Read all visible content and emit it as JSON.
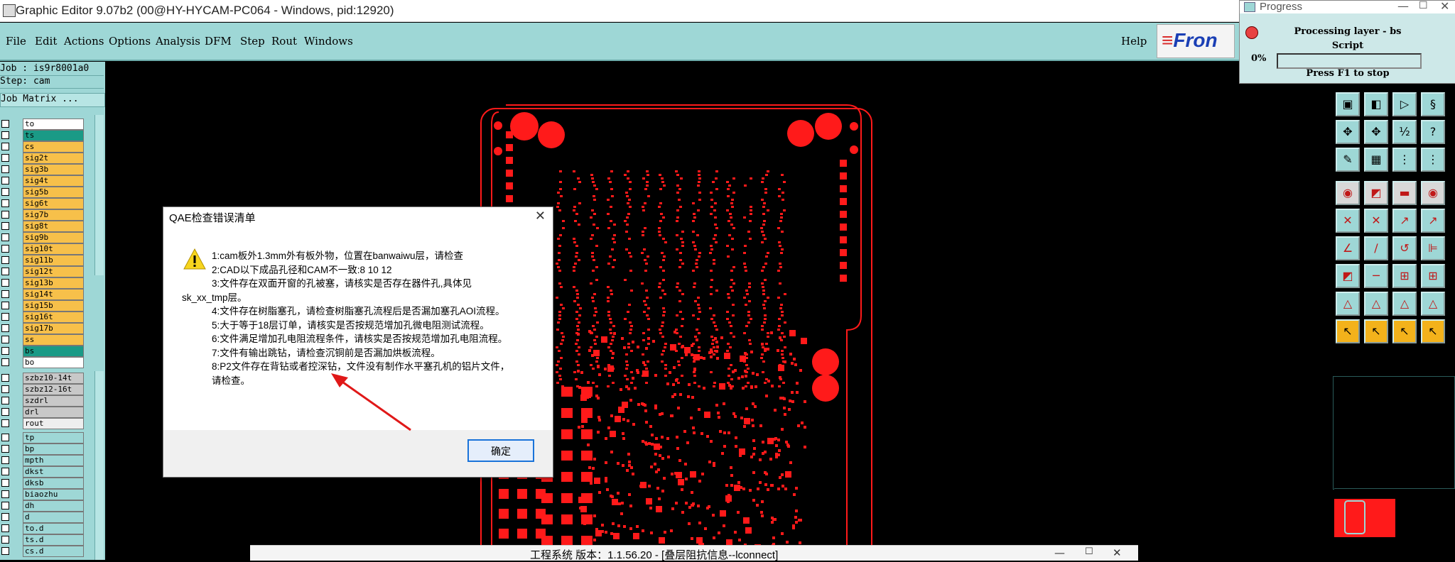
{
  "window": {
    "title": "Graphic Editor 9.07b2 (00@HY-HYCAM-PC064 - Windows, pid:12920)"
  },
  "menubar": {
    "items": [
      "File",
      "Edit",
      "Actions",
      "Options",
      "Analysis",
      "DFM",
      "Step",
      "Rout",
      "Windows"
    ],
    "help": "Help",
    "logo_text": "Fron"
  },
  "left_panel": {
    "job": "Job : is9r8001a0",
    "step": "Step: cam",
    "job_matrix": "Job Matrix ...",
    "layers_group1": [
      {
        "name": "to",
        "color": "#ffffff"
      },
      {
        "name": "ts",
        "color": "#1a9a86"
      },
      {
        "name": "cs",
        "color": "#f7c04a"
      },
      {
        "name": "sig2t",
        "color": "#f7c04a"
      },
      {
        "name": "sig3b",
        "color": "#f7c04a"
      },
      {
        "name": "sig4t",
        "color": "#f7c04a"
      },
      {
        "name": "sig5b",
        "color": "#f7c04a"
      },
      {
        "name": "sig6t",
        "color": "#f7c04a"
      },
      {
        "name": "sig7b",
        "color": "#f7c04a"
      },
      {
        "name": "sig8t",
        "color": "#f7c04a"
      },
      {
        "name": "sig9b",
        "color": "#f7c04a"
      },
      {
        "name": "sig10t",
        "color": "#f7c04a"
      },
      {
        "name": "sig11b",
        "color": "#f7c04a"
      },
      {
        "name": "sig12t",
        "color": "#f7c04a"
      },
      {
        "name": "sig13b",
        "color": "#f7c04a"
      },
      {
        "name": "sig14t",
        "color": "#f7c04a"
      },
      {
        "name": "sig15b",
        "color": "#f7c04a"
      },
      {
        "name": "sig16t",
        "color": "#f7c04a"
      },
      {
        "name": "sig17b",
        "color": "#f7c04a"
      },
      {
        "name": "ss",
        "color": "#f7c04a"
      },
      {
        "name": "bs",
        "color": "#1a9a86"
      },
      {
        "name": "bo",
        "color": "#ffffff"
      }
    ],
    "layers_group2": [
      {
        "name": "szbz10-14t",
        "color": "#c8c8c8"
      },
      {
        "name": "szbz12-16t",
        "color": "#c8c8c8"
      },
      {
        "name": "szdrl",
        "color": "#c8c8c8"
      },
      {
        "name": "drl",
        "color": "#c8c8c8"
      },
      {
        "name": "rout",
        "color": "#eeeeee"
      }
    ],
    "layers_group3": [
      {
        "name": "tp",
        "color": "#9ed7d6"
      },
      {
        "name": "bp",
        "color": "#9ed7d6"
      },
      {
        "name": "mpth",
        "color": "#9ed7d6"
      },
      {
        "name": "dkst",
        "color": "#9ed7d6"
      },
      {
        "name": "dksb",
        "color": "#9ed7d6"
      },
      {
        "name": "biaozhu",
        "color": "#9ed7d6"
      },
      {
        "name": "dh",
        "color": "#9ed7d6"
      },
      {
        "name": "d",
        "color": "#9ed7d6"
      },
      {
        "name": "to.d",
        "color": "#9ed7d6"
      },
      {
        "name": "ts.d",
        "color": "#9ed7d6"
      },
      {
        "name": "cs.d",
        "color": "#9ed7d6"
      }
    ]
  },
  "progress": {
    "window_title": "Progress",
    "line1": "Processing layer - bs",
    "line2": "Script",
    "percent": "0%",
    "progress_value": 0,
    "footer": "Press F1 to stop"
  },
  "qae_dialog": {
    "title": "QAE检查错误清单",
    "messages": [
      "1:cam板外1.3mm外有板外物，位置在banwaiwu层，请检查",
      "2:CAD以下成品孔径和CAM不一致:8 10 12",
      "3:文件存在双面开窗的孔被塞，请核实是否存在器件孔,具体见",
      "sk_xx_tmp层。",
      "4:文件存在树脂塞孔，请检查树脂塞孔流程后是否漏加塞孔AOI流程。",
      "5:大于等于18层订单，请核实是否按规范增加孔微电阻测试流程。",
      "6:文件满足增加孔电阻流程条件，请核实是否按规范增加孔电阻流程。",
      "7:文件有输出跳钻，请检查沉铜前是否漏加烘板流程。",
      "8:P2文件存在背钻或者控深钻，文件没有制作水平塞孔机的铝片文件，",
      "请检查。"
    ],
    "ok_label": "确定"
  },
  "bottom_window": {
    "title": "工程系统   版本：1.1.56.20 - [叠层阻抗信息--lconnect]"
  },
  "colors": {
    "menu_bg": "#9ed7d6",
    "canvas_bg": "#000000",
    "board_red": "#ff1a1a",
    "tool_yellow": "#f3b21b"
  },
  "icons": [
    "window-app-icon",
    "close-icon",
    "warning-icon",
    "arrow-annotation"
  ]
}
